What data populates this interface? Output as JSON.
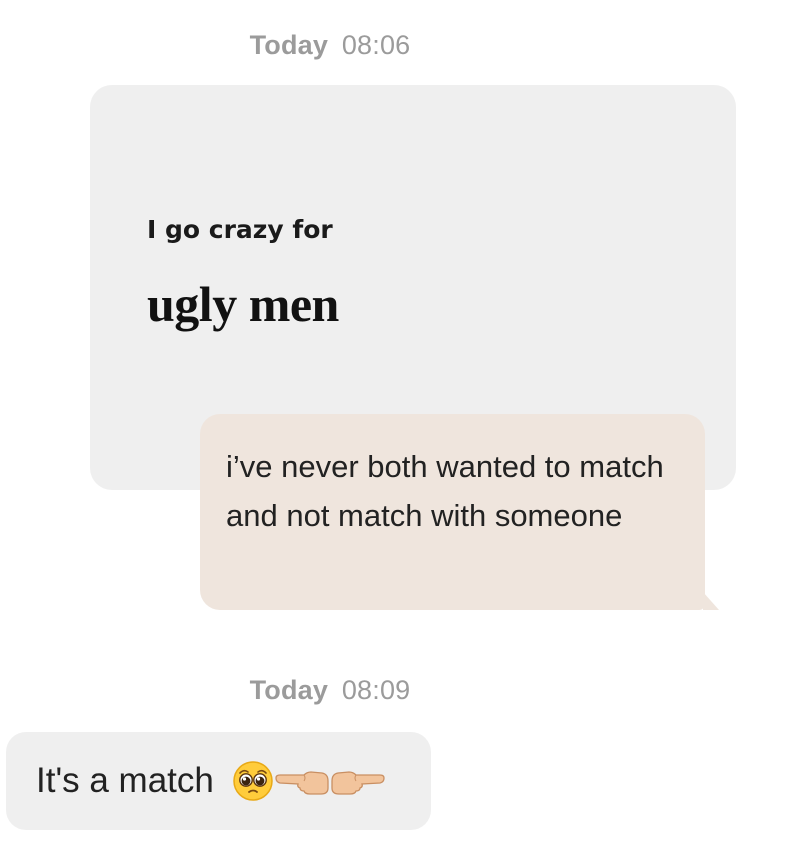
{
  "chat": {
    "timestamp_1": {
      "day": "Today",
      "time": "08:06"
    },
    "prompt": {
      "question": "I go crazy for",
      "answer": "ugly men"
    },
    "reply": {
      "text": "i’ve never both wanted to match and not match with someone",
      "bubble_color": "#efe5dd"
    },
    "timestamp_2": {
      "day": "Today",
      "time": "08:09"
    },
    "match_message": {
      "text": "It's a match",
      "emojis": [
        "pleading-face-icon",
        "pointing-left-icon",
        "pointing-right-icon"
      ]
    }
  },
  "colors": {
    "background": "#ffffff",
    "prompt_card": "#efefef",
    "timestamp": "#9b9b9b",
    "text": "#222222"
  }
}
